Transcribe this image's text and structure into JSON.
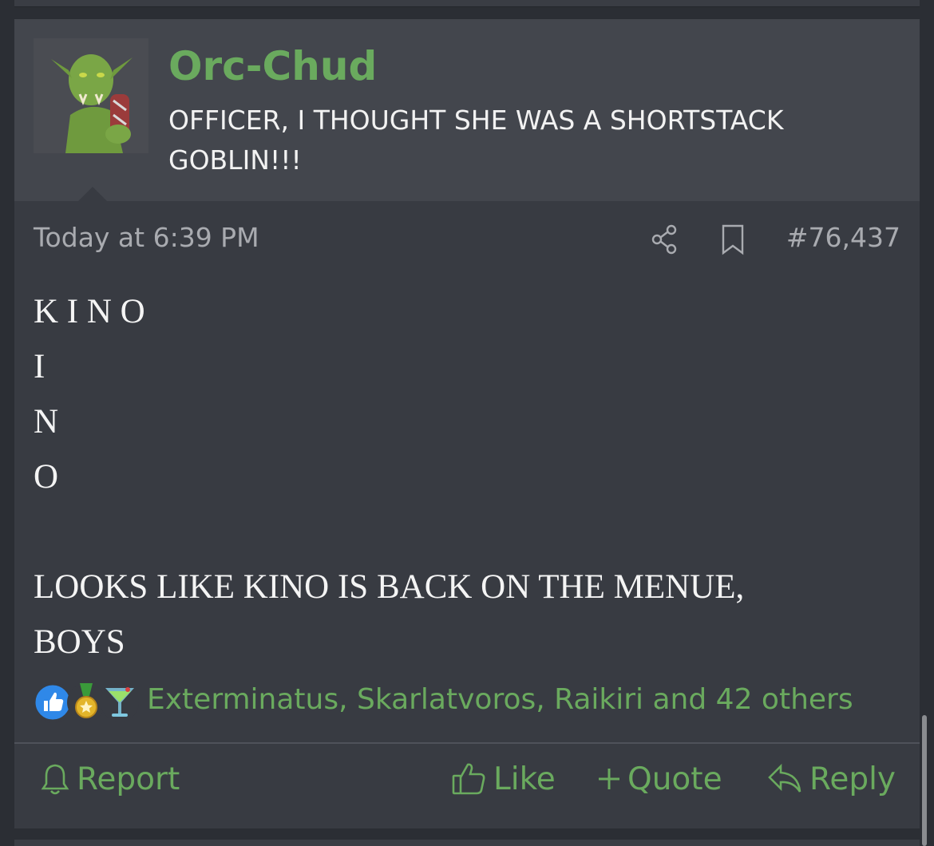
{
  "post": {
    "username": "Orc-Chud",
    "user_title": "OFFICER, I THOUGHT SHE WAS A SHORTSTACK GOBLIN!!!",
    "date": "Today at 6:39 PM",
    "post_number": "#76,437",
    "body_lines": [
      "K I N O",
      "I",
      "N",
      "O",
      "",
      "LOOKS LIKE KINO IS BACK ON THE MENUE,",
      "BOYS"
    ],
    "reactions": {
      "icons": [
        "like-icon",
        "medal-icon",
        "cocktail-icon"
      ],
      "text": "Exterminatus, Skarlatvoros, Raikiri and 42 others"
    },
    "actions": {
      "report": "Report",
      "like": "Like",
      "quote": "Quote",
      "reply": "Reply"
    }
  },
  "colors": {
    "accent_green": "#6aaa5e",
    "header_bg": "#43464d",
    "post_bg": "#383b42",
    "meta_text": "#a9abb0"
  }
}
